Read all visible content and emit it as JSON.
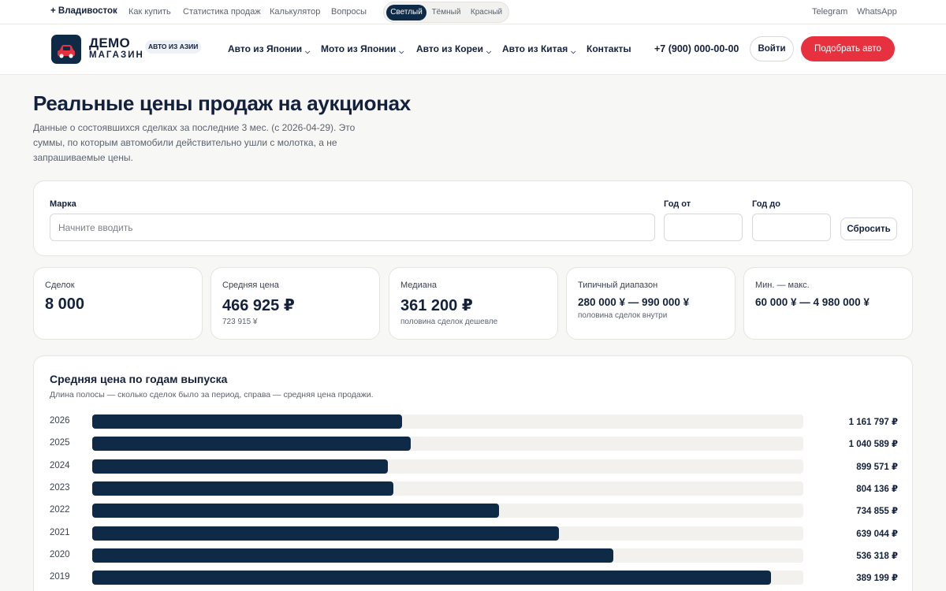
{
  "topbar": {
    "city": "+ Владивосток",
    "links": [
      "Как купить",
      "Статистика продаж",
      "Калькулятор",
      "Вопросы"
    ],
    "theme_options": [
      "Светлый",
      "Тёмный",
      "Красный"
    ],
    "theme_active": "Светлый",
    "social": [
      "Telegram",
      "WhatsApp"
    ]
  },
  "header": {
    "logo_title": "ДЕМО",
    "logo_sub": "МАГАЗИН",
    "logo_badge": "АВТО ИЗ АЗИИ",
    "nav": [
      "Авто из Японии",
      "Мото из Японии",
      "Авто из Кореи",
      "Авто из Китая",
      "Контакты"
    ],
    "phone": "+7 (900) 000-00-00",
    "login_label": "Войти",
    "pick_label": "Подобрать авто"
  },
  "page": {
    "title": "Реальные цены продаж на аукционах",
    "description": "Данные о состоявшихся сделках за последние 3 мес. (с 2026-04-29). Это суммы, по которым автомобили действительно ушли с молотка, а не запрашиваемые цены."
  },
  "filters": {
    "brand_label": "Марка",
    "brand_placeholder": "Начните вводить",
    "year_from_label": "Год от",
    "year_to_label": "Год до",
    "reset_label": "Сбросить"
  },
  "stats": [
    {
      "label": "Сделок",
      "value": "8 000",
      "sub": ""
    },
    {
      "label": "Средняя цена",
      "value": "466 925 ₽",
      "sub": "723 915 ¥"
    },
    {
      "label": "Медиана",
      "value": "361 200 ₽",
      "sub": "половина сделок дешевле"
    },
    {
      "label": "Типичный диапазон",
      "value": "280 000 ¥ — 990 000 ¥",
      "sub": "половина сделок внутри"
    },
    {
      "label": "Мин. — макс.",
      "value": "60 000 ¥ — 4 980 000 ¥",
      "sub": ""
    }
  ],
  "chart": {
    "title": "Средняя цена по годам выпуска",
    "subtitle": "Длина полосы — сколько сделок было за период, справа — средняя цена продажи."
  },
  "chart_data": {
    "type": "bar",
    "orientation": "horizontal",
    "categories": [
      "2026",
      "2025",
      "2024",
      "2023",
      "2022",
      "2021",
      "2020",
      "2019"
    ],
    "bar_fraction": [
      0.436,
      0.448,
      0.416,
      0.423,
      0.572,
      0.656,
      0.733,
      0.955
    ],
    "price_labels": [
      "1 161 797 ₽",
      "1 040 589 ₽",
      "899 571 ₽",
      "804 136 ₽",
      "734 855 ₽",
      "639 044 ₽",
      "536 318 ₽",
      "389 199 ₽"
    ],
    "colors": {
      "bar": "#0f2a47",
      "track": "#f2f1ed"
    }
  }
}
